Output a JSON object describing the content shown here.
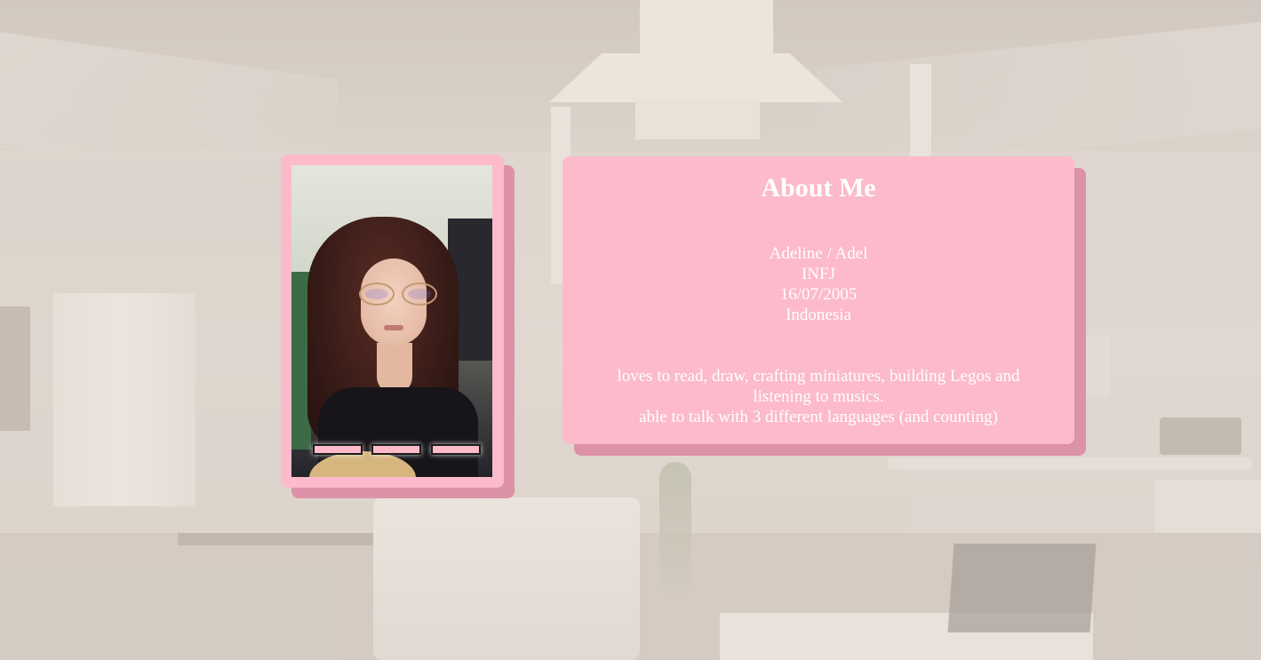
{
  "theme": {
    "card_color": "#fcbacb",
    "card_shadow_color": "#dc92a7",
    "text_color": "#ffffff"
  },
  "photo_card": {
    "image": "profile-photo",
    "indicators": [
      "indicator-1",
      "indicator-2",
      "indicator-3"
    ]
  },
  "about": {
    "title": "About Me",
    "name": "Adeline / Adel",
    "personality": "INFJ",
    "birthdate": "16/07/2005",
    "country": "Indonesia",
    "bio_line_1": "loves to read, draw, crafting miniatures, building Legos and listening to musics.",
    "bio_line_2": "able to talk with 3 different languages (and counting)"
  }
}
